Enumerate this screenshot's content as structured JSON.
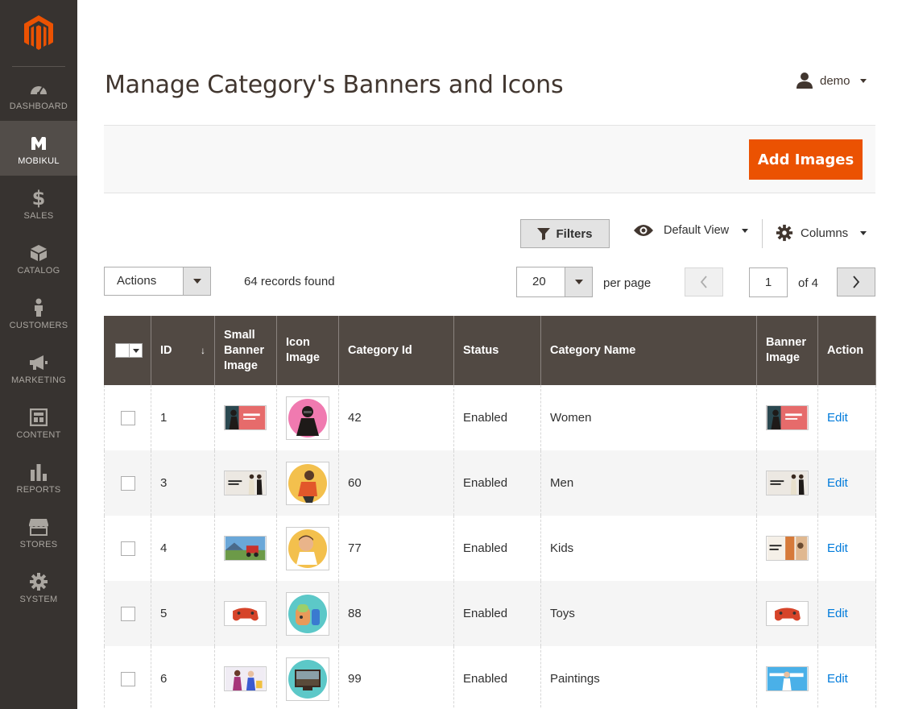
{
  "sidebar": {
    "items": [
      {
        "label": "Dashboard",
        "icon": "dashboard-icon"
      },
      {
        "label": "Mobikul",
        "icon": "mobikul-icon"
      },
      {
        "label": "Sales",
        "icon": "dollar-icon"
      },
      {
        "label": "Catalog",
        "icon": "box-icon"
      },
      {
        "label": "Customers",
        "icon": "person-icon"
      },
      {
        "label": "Marketing",
        "icon": "megaphone-icon"
      },
      {
        "label": "Content",
        "icon": "layout-icon"
      },
      {
        "label": "Reports",
        "icon": "bar-chart-icon"
      },
      {
        "label": "Stores",
        "icon": "store-icon"
      },
      {
        "label": "System",
        "icon": "gear-icon"
      }
    ],
    "active_index": 1
  },
  "header": {
    "title": "Manage Category's Banners and Icons",
    "user": "demo"
  },
  "action_bar": {
    "add_label": "Add Images"
  },
  "toolbar": {
    "filters_label": "Filters",
    "view_label": "Default View",
    "columns_label": "Columns",
    "actions_label": "Actions",
    "records_text": "64 records found",
    "per_page_value": "20",
    "per_page_label": "per page",
    "current_page": "1",
    "page_of": "of 4"
  },
  "grid": {
    "headers": {
      "id": "ID",
      "small_banner_line1": "Small",
      "small_banner_line2": "Banner",
      "small_banner_line3": "Image",
      "icon_line1": "Icon",
      "icon_line2": "Image",
      "category_id": "Category Id",
      "status": "Status",
      "category_name": "Category Name",
      "banner_line1": "Banner",
      "banner_line2": "Image",
      "action": "Action"
    },
    "rows": [
      {
        "id": "1",
        "category_id": "42",
        "status": "Enabled",
        "category_name": "Women",
        "action": "Edit"
      },
      {
        "id": "3",
        "category_id": "60",
        "status": "Enabled",
        "category_name": "Men",
        "action": "Edit"
      },
      {
        "id": "4",
        "category_id": "77",
        "status": "Enabled",
        "category_name": "Kids",
        "action": "Edit"
      },
      {
        "id": "5",
        "category_id": "88",
        "status": "Enabled",
        "category_name": "Toys",
        "action": "Edit"
      },
      {
        "id": "6",
        "category_id": "99",
        "status": "Enabled",
        "category_name": "Paintings",
        "action": "Edit"
      }
    ]
  },
  "colors": {
    "sidebar_bg": "#373330",
    "sidebar_active": "#524d49",
    "accent_orange": "#eb5202",
    "grid_header": "#514943",
    "link": "#007bdb"
  }
}
